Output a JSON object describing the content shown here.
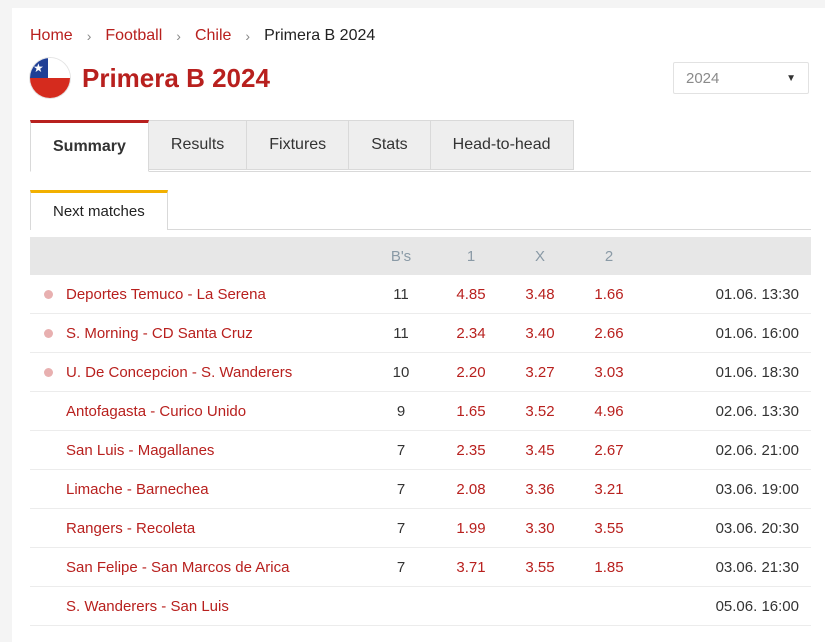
{
  "breadcrumb": {
    "items": [
      "Home",
      "Football",
      "Chile"
    ],
    "current": "Primera B 2024"
  },
  "page_title": "Primera B 2024",
  "season_select": {
    "value": "2024"
  },
  "tabs": [
    "Summary",
    "Results",
    "Fixtures",
    "Stats",
    "Head-to-head"
  ],
  "subtab": "Next matches",
  "table": {
    "headers": {
      "bs": "B's",
      "o1": "1",
      "ox": "X",
      "o2": "2"
    },
    "rows": [
      {
        "live": true,
        "match": "Deportes Temuco - La Serena",
        "bs": "11",
        "o1": "4.85",
        "ox": "3.48",
        "o2": "1.66",
        "time": "01.06. 13:30"
      },
      {
        "live": true,
        "match": "S. Morning - CD Santa Cruz",
        "bs": "11",
        "o1": "2.34",
        "ox": "3.40",
        "o2": "2.66",
        "time": "01.06. 16:00"
      },
      {
        "live": true,
        "match": "U. De Concepcion - S. Wanderers",
        "bs": "10",
        "o1": "2.20",
        "ox": "3.27",
        "o2": "3.03",
        "time": "01.06. 18:30"
      },
      {
        "live": false,
        "match": "Antofagasta - Curico Unido",
        "bs": "9",
        "o1": "1.65",
        "ox": "3.52",
        "o2": "4.96",
        "time": "02.06. 13:30"
      },
      {
        "live": false,
        "match": "San Luis - Magallanes",
        "bs": "7",
        "o1": "2.35",
        "ox": "3.45",
        "o2": "2.67",
        "time": "02.06. 21:00"
      },
      {
        "live": false,
        "match": "Limache - Barnechea",
        "bs": "7",
        "o1": "2.08",
        "ox": "3.36",
        "o2": "3.21",
        "time": "03.06. 19:00"
      },
      {
        "live": false,
        "match": "Rangers - Recoleta",
        "bs": "7",
        "o1": "1.99",
        "ox": "3.30",
        "o2": "3.55",
        "time": "03.06. 20:30"
      },
      {
        "live": false,
        "match": "San Felipe - San Marcos de Arica",
        "bs": "7",
        "o1": "3.71",
        "ox": "3.55",
        "o2": "1.85",
        "time": "03.06. 21:30"
      },
      {
        "live": false,
        "match": "S. Wanderers - San Luis",
        "bs": "",
        "o1": "",
        "ox": "",
        "o2": "",
        "time": "05.06. 16:00"
      }
    ]
  },
  "colors": {
    "accent": "#b8201e",
    "subtab_accent": "#f2b000",
    "dot": "#e8b0b0"
  }
}
